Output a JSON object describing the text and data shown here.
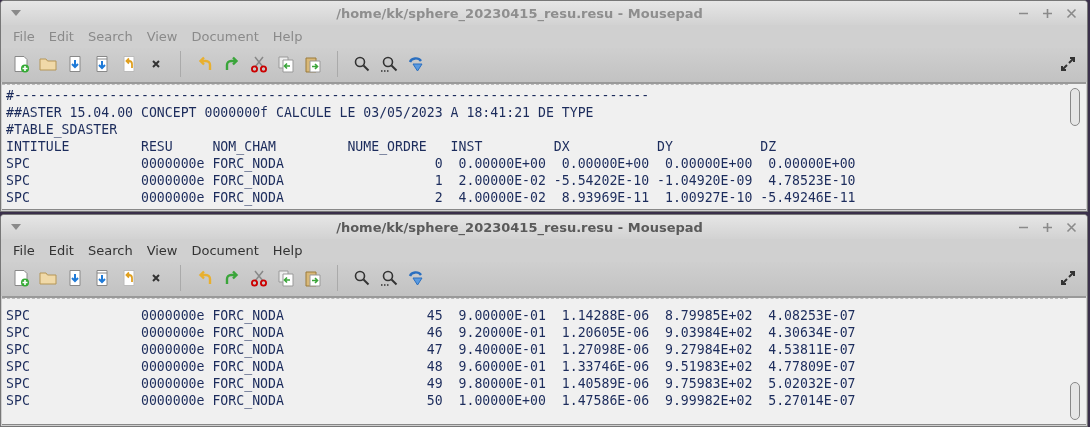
{
  "windows": [
    {
      "title": "/home/kk/sphere_20230415_resu.resu - Mousepad",
      "active": false,
      "menu": [
        {
          "label": "File"
        },
        {
          "label": "Edit"
        },
        {
          "label": "Search"
        },
        {
          "label": "View"
        },
        {
          "label": "Document"
        },
        {
          "label": "Help"
        }
      ],
      "lines": [
        "#--------------------------------------------------------------------------------",
        "##ASTER 15.04.00 CONCEPT 0000000f CALCULE LE 03/05/2023 A 18:41:21 DE TYPE",
        "#TABLE_SDASTER",
        "INTITULE         RESU     NOM_CHAM         NUME_ORDRE   INST         DX           DY           DZ",
        "SPC              0000000e FORC_NODA                   0  0.00000E+00  0.00000E+00  0.00000E+00  0.00000E+00",
        "SPC              0000000e FORC_NODA                   1  2.00000E-02 -5.54202E-10 -1.04920E-09  4.78523E-10",
        "SPC              0000000e FORC_NODA                   2  4.00000E-02  8.93969E-11  1.00927E-10 -5.49246E-11"
      ]
    },
    {
      "title": "/home/kk/sphere_20230415_resu.resu - Mousepad",
      "active": true,
      "menu": [
        {
          "label": "File"
        },
        {
          "label": "Edit"
        },
        {
          "label": "Search"
        },
        {
          "label": "View"
        },
        {
          "label": "Document"
        },
        {
          "label": "Help"
        }
      ],
      "lines": [
        "SPC              0000000e FORC_NODA                  45  9.00000E-01  1.14288E-06  8.79985E+02  4.08253E-07",
        "SPC              0000000e FORC_NODA                  46  9.20000E-01  1.20605E-06  9.03984E+02  4.30634E-07",
        "SPC              0000000e FORC_NODA                  47  9.40000E-01  1.27098E-06  9.27984E+02  4.53811E-07",
        "SPC              0000000e FORC_NODA                  48  9.60000E-01  1.33746E-06  9.51983E+02  4.77809E-07",
        "SPC              0000000e FORC_NODA                  49  9.80000E-01  1.40589E-06  9.75983E+02  5.02032E-07",
        "SPC              0000000e FORC_NODA                  50  1.00000E+00  1.47586E-06  9.99982E+02  5.27014E-07"
      ]
    }
  ]
}
